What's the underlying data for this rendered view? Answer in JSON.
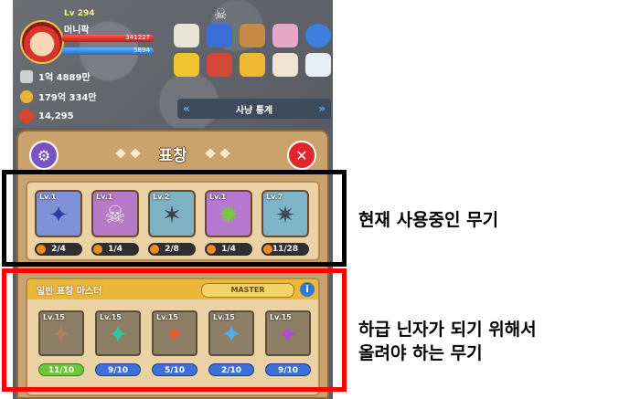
{
  "player": {
    "level": "Lv 294",
    "name": "머니팍",
    "hp": "341227",
    "mp": "5894"
  },
  "stats": [
    {
      "icon": "attack-icon",
      "value": "1억 4889만",
      "color": "#cfcfcf"
    },
    {
      "icon": "gold-coin-icon",
      "value": "179억 334만",
      "color": "#e7b43a"
    },
    {
      "icon": "red-gem-icon",
      "value": "14,295",
      "color": "#d8452c"
    }
  ],
  "menu_icons": [
    "card-box-icon",
    "book-icon",
    "glove-icon",
    "gift-icon",
    "list-icon",
    "friends-icon",
    "banner-icon",
    "trophy-icon",
    "pet-icon",
    "scroll-icon"
  ],
  "hunt": {
    "label": "사냥 통계"
  },
  "panel": {
    "title": "표창"
  },
  "equipped": [
    {
      "level": "Lv.1",
      "count": "2/4",
      "bg": "#7f92d8",
      "color": "#2b3fa3",
      "glyph": "✦"
    },
    {
      "level": "Lv.1",
      "count": "1/4",
      "bg": "#b77ac6",
      "color": "#e9e2ef",
      "glyph": "☠"
    },
    {
      "level": "Lv.2",
      "count": "2/8",
      "bg": "#7eb1c3",
      "color": "#3a3f47",
      "glyph": "✶"
    },
    {
      "level": "Lv.1",
      "count": "1/4",
      "bg": "#b57ad0",
      "color": "#79c63c",
      "glyph": "✹"
    },
    {
      "level": "Lv.7",
      "count": "11/28",
      "bg": "#7fb4c9",
      "color": "#3e4a55",
      "glyph": "✷"
    }
  ],
  "master": {
    "title": "일반 표창 마스터",
    "badge": "MASTER",
    "info": "i",
    "items": [
      {
        "level": "Lv.15",
        "count": "11/10",
        "color": "#b07f5f",
        "count_bg": "#6bc63a",
        "glyph": "✦"
      },
      {
        "level": "Lv.15",
        "count": "9/10",
        "color": "#2ec6a4",
        "count_bg": "#3c6fd8",
        "glyph": "✦"
      },
      {
        "level": "Lv.15",
        "count": "5/10",
        "color": "#e0602a",
        "count_bg": "#3c6fd8",
        "glyph": "✦"
      },
      {
        "level": "Lv.15",
        "count": "2/10",
        "color": "#47b6e8",
        "count_bg": "#3c6fd8",
        "glyph": "✦"
      },
      {
        "level": "Lv.15",
        "count": "9/10",
        "color": "#b44ad8",
        "count_bg": "#3c6fd8",
        "glyph": "✦"
      }
    ]
  },
  "annotations": {
    "current": "현재 사용중인 무기",
    "upgrade_line1": "하급 닌자가 되기 위해서",
    "upgrade_line2": "올려야 하는 무기"
  }
}
